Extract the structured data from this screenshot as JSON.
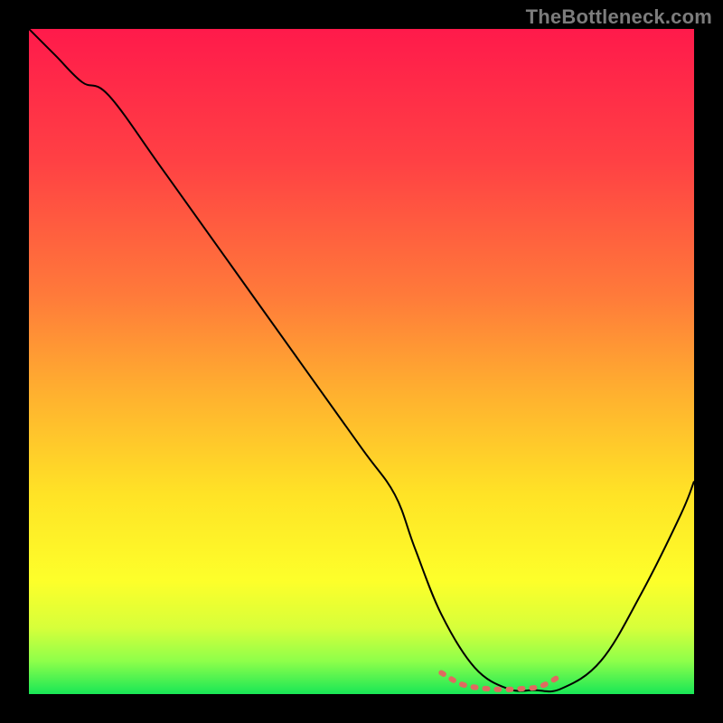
{
  "watermark": "TheBottleneck.com",
  "chart_data": {
    "type": "line",
    "title": "",
    "xlabel": "",
    "ylabel": "",
    "xlim": [
      0,
      100
    ],
    "ylim": [
      0,
      100
    ],
    "grid": false,
    "background": {
      "type": "vertical-gradient",
      "stops": [
        {
          "offset": 0.0,
          "color": "#ff1a4b"
        },
        {
          "offset": 0.2,
          "color": "#ff4144"
        },
        {
          "offset": 0.4,
          "color": "#ff7a3a"
        },
        {
          "offset": 0.55,
          "color": "#ffb12f"
        },
        {
          "offset": 0.7,
          "color": "#ffe326"
        },
        {
          "offset": 0.83,
          "color": "#fdff2a"
        },
        {
          "offset": 0.9,
          "color": "#d7ff3a"
        },
        {
          "offset": 0.95,
          "color": "#8fff4a"
        },
        {
          "offset": 1.0,
          "color": "#18e756"
        }
      ]
    },
    "series": [
      {
        "name": "bottleneck-curve",
        "color": "#000000",
        "width": 2,
        "x": [
          0,
          4,
          8,
          12,
          20,
          30,
          40,
          50,
          55,
          58,
          62,
          67,
          72,
          76,
          80,
          86,
          92,
          98,
          100
        ],
        "y": [
          100,
          96,
          92,
          90,
          79,
          65,
          51,
          37,
          30,
          22,
          12,
          4,
          0.8,
          0.6,
          0.8,
          5,
          15,
          27,
          32
        ]
      },
      {
        "name": "optimal-band",
        "color": "#e06a60",
        "width": 6,
        "dash": "3 10",
        "x": [
          62,
          65,
          68,
          71,
          74,
          77,
          80
        ],
        "y": [
          3.2,
          1.5,
          0.9,
          0.7,
          0.8,
          1.2,
          2.8
        ]
      }
    ]
  }
}
